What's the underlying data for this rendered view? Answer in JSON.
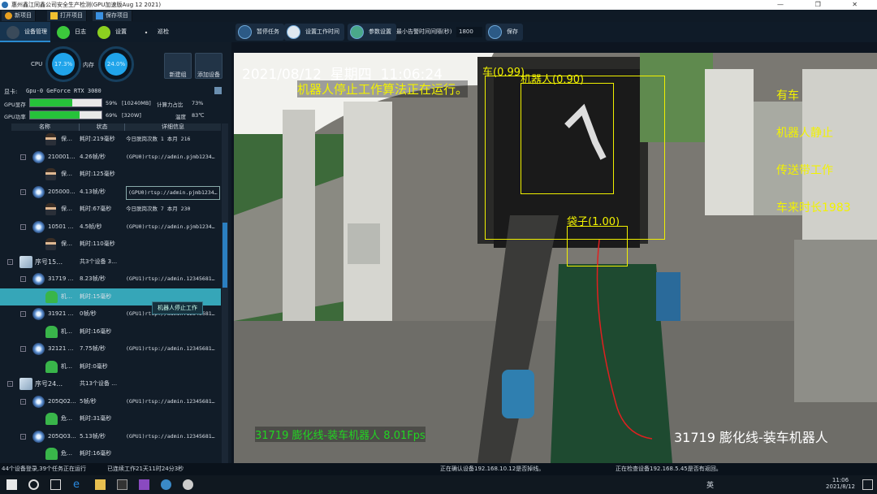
{
  "window": {
    "title": "惠州鑫江同鑫公司安全生产检测(GPU加速版Aug 12 2021)",
    "controls": "— ❐ ✕"
  },
  "toolbar1": [
    {
      "label": "新项目",
      "icon": "new-project-icon"
    },
    {
      "label": "打开项目",
      "icon": "folder-icon"
    },
    {
      "label": "保存项目",
      "icon": "save-icon"
    }
  ],
  "tabs": [
    {
      "label": "设备管理",
      "icon": "device-icon",
      "active": true
    },
    {
      "label": "日志",
      "icon": "chat-icon"
    },
    {
      "label": "设置",
      "icon": "gear-icon"
    },
    {
      "label": "巡检",
      "icon": "dots-icon"
    }
  ],
  "actions": {
    "pause": "暂停任务",
    "work_time": "设置工作时间",
    "params": "参数设置",
    "min_interval_label": "最小告警时间间隔(秒)",
    "min_interval_value": "1800",
    "save": "保存"
  },
  "stats": {
    "cpu_label": "CPU",
    "cpu": "17.3%",
    "mem_label": "内存",
    "mem": "24.0%",
    "new_group": "新建组",
    "add_device": "添加设备",
    "gpu_label": "显卡:",
    "gpu_value": "Gpu-0 GeForce RTX 3080",
    "vram_label": "GPU显存",
    "vram_pct": 59,
    "vram_text": "59%",
    "vram_size": "[10240MB]",
    "compute_label": "计算力占比",
    "compute": "73%",
    "power_label": "GPU功率",
    "power_pct": 69,
    "power_text": "69%",
    "power_size": "[320W]",
    "temp_label": "温度",
    "temp": "83℃"
  },
  "tree": {
    "columns": [
      "名称",
      "状态",
      "详细信息"
    ],
    "rows": [
      {
        "t": "p",
        "lvl": 2,
        "name": "保…",
        "status": "耗时:219毫秒",
        "detail": "今日脱岗次数 1 本月 216"
      },
      {
        "t": "c",
        "lvl": 1,
        "name": "210001…",
        "status": "4.26帧/秒",
        "detail": "(GPU0)rtsp://admin.pjmb1234…"
      },
      {
        "t": "p",
        "lvl": 2,
        "name": "保…",
        "status": "耗时:125毫秒",
        "detail": ""
      },
      {
        "t": "c",
        "lvl": 1,
        "name": "205000…",
        "status": "4.13帧/秒",
        "detail": "(GPU0)rtsp://admin.pjmb1234…",
        "boxed": true
      },
      {
        "t": "p",
        "lvl": 2,
        "name": "保…",
        "status": "耗时:67毫秒",
        "detail": "今日脱岗次数 7 本月 230"
      },
      {
        "t": "c",
        "lvl": 1,
        "name": "10501 …",
        "status": "4.5帧/秒",
        "detail": "(GPU0)rtsp://admin.pjmb1234…"
      },
      {
        "t": "p",
        "lvl": 2,
        "name": "保…",
        "status": "耗时:110毫秒",
        "detail": ""
      },
      {
        "t": "g",
        "lvl": 0,
        "name": "序号15…",
        "status": "共3个设备 3…",
        "detail": ""
      },
      {
        "t": "c",
        "lvl": 1,
        "name": "31719 …",
        "status": "8.23帧/秒",
        "detail": "(GPU1)rtsp://admin.12345681…"
      },
      {
        "t": "r",
        "lvl": 2,
        "name": "机…",
        "status": "耗时:15毫秒",
        "detail": "",
        "selected": true
      },
      {
        "t": "c",
        "lvl": 1,
        "name": "31921 …",
        "status": "0帧/秒",
        "detail": "(GPU1)rtsp://admin.12345681…"
      },
      {
        "t": "r",
        "lvl": 2,
        "name": "机…",
        "status": "耗时:16毫秒",
        "detail": ""
      },
      {
        "t": "c",
        "lvl": 1,
        "name": "32121 …",
        "status": "7.75帧/秒",
        "detail": "(GPU1)rtsp://admin.12345681…"
      },
      {
        "t": "r",
        "lvl": 2,
        "name": "机…",
        "status": "耗时:0毫秒",
        "detail": ""
      },
      {
        "t": "g",
        "lvl": 0,
        "name": "序号24…",
        "status": "共13个设备 …",
        "detail": ""
      },
      {
        "t": "c",
        "lvl": 1,
        "name": "205Q02…",
        "status": "5帧/秒",
        "detail": "(GPU1)rtsp://admin.12345681…"
      },
      {
        "t": "r",
        "lvl": 2,
        "name": "危…",
        "status": "耗时:31毫秒",
        "detail": ""
      },
      {
        "t": "c",
        "lvl": 1,
        "name": "205Q03…",
        "status": "5.13帧/秒",
        "detail": "(GPU1)rtsp://admin.12345681…"
      },
      {
        "t": "r",
        "lvl": 2,
        "name": "危…",
        "status": "耗时:16毫秒",
        "detail": ""
      }
    ],
    "tooltip": "机器人停止工作"
  },
  "video": {
    "datetime": "2021/08/12",
    "weekday": "星期四",
    "time": "11:06:24",
    "algo": "机器人停止工作算法正在运行。",
    "det_car": "车(0.99)",
    "det_robot": "机器人(0.90)",
    "det_bag": "袋子(1.00)",
    "status_lines": [
      "有车",
      "机器人静止",
      "传送带工作",
      "车来时长1983"
    ],
    "fps_caption": "31719  膨化线-装车机器人  8.01Fps",
    "camera_caption": "31719  膨化线-装车机器人"
  },
  "statusbar": {
    "devices": "44个设备登录,39个任务正在运行",
    "uptime": "已连续工作21天11时24分3秒",
    "msg1": "正在确认设备192.168.10.12是否掉线。",
    "msg2": "正在检查设备192.168.5.45是否有返回。"
  },
  "taskbar": {
    "tray": "英",
    "time": "11:06",
    "date": "2021/8/12"
  },
  "colors": {
    "accent": "#20a4ea",
    "overlay_yellow": "#f0f000",
    "overlay_green": "#22d522",
    "selected": "#36a6b8",
    "bar": "#26c23a"
  }
}
